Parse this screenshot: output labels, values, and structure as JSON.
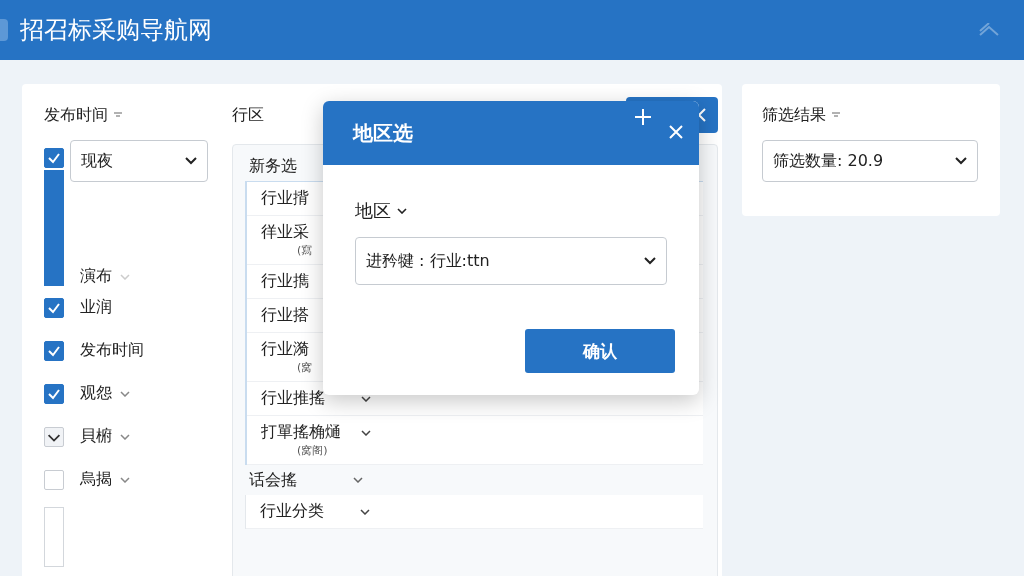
{
  "header": {
    "title": "招召标采购导航网"
  },
  "left_panel": {
    "title": "发布时间",
    "first": {
      "checked": true,
      "value": "现夜"
    },
    "sub_label": "演布",
    "items": [
      {
        "label": "业润",
        "kind": "checkbox",
        "checked": true,
        "chevron": false
      },
      {
        "label": "发布时间",
        "kind": "checkbox",
        "checked": true,
        "chevron": false
      },
      {
        "label": "观怨",
        "kind": "checkbox",
        "checked": true,
        "chevron": true
      },
      {
        "label": "貝椨",
        "kind": "expander",
        "chevron": true
      },
      {
        "label": "烏揭",
        "kind": "checkbox",
        "checked": false,
        "chevron": true
      }
    ]
  },
  "middle_panel": {
    "title": "行区",
    "groups": [
      {
        "label": "新务选",
        "chevron": false,
        "items": [
          {
            "label": "行业揹",
            "chevron": false
          },
          {
            "label": "徉业采",
            "note": "(寫",
            "chevron": false
          },
          {
            "label": "行业擕",
            "chevron": false
          },
          {
            "label": "行业搭",
            "chevron": false
          },
          {
            "label": "行业漪",
            "note": "(窝",
            "chevron": false
          },
          {
            "label": "行业推搖",
            "chevron": true
          },
          {
            "label": "打單搖桷熥",
            "note": "(窝阁)",
            "chevron": true
          }
        ]
      },
      {
        "label": "话会搖",
        "chevron": true,
        "items": [
          {
            "label": "行业分类",
            "chevron": true
          }
        ]
      }
    ]
  },
  "right_panel": {
    "title": "筛选结果",
    "select": "筛选数量: 20.9"
  },
  "dialog": {
    "title": "地区选",
    "field_label": "地区",
    "select": "进矜犍 : 行业:ttn",
    "confirm": "确认"
  }
}
